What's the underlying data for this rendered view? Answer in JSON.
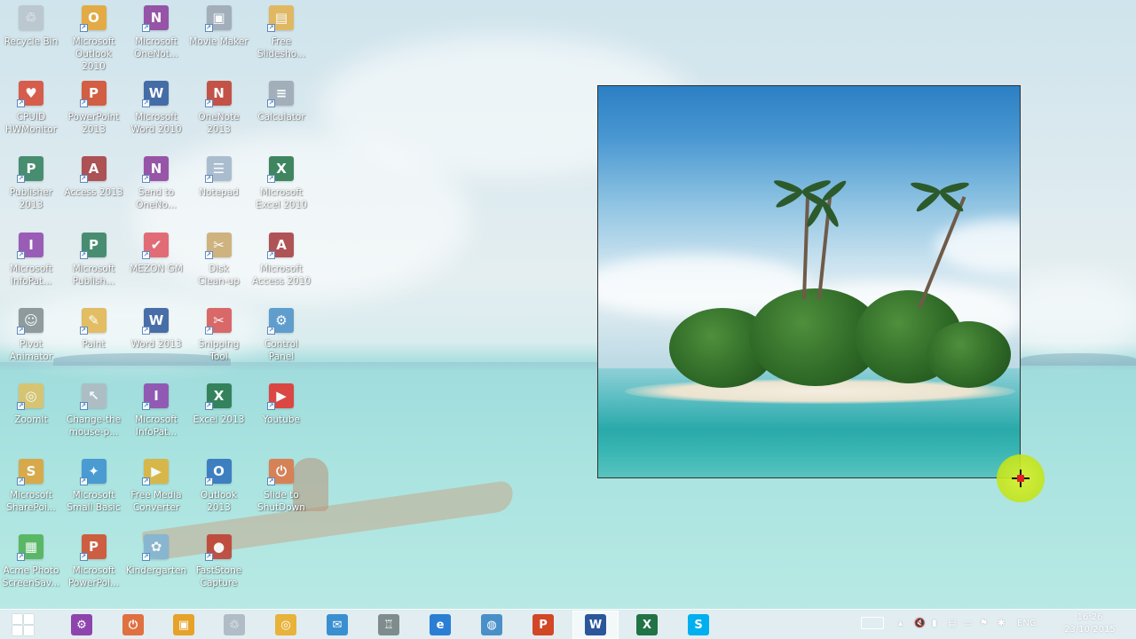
{
  "desktop_icons": [
    {
      "label": "Recycle Bin",
      "icon": "recycle-bin-icon",
      "color": "#b8c4cc"
    },
    {
      "label": "Microsoft\nOutlook 2010",
      "icon": "outlook-icon",
      "color": "#e6a229"
    },
    {
      "label": "Microsoft\nOneNot...",
      "icon": "onenote-icon",
      "color": "#8b3b9b"
    },
    {
      "label": "Movie Maker",
      "icon": "movie-maker-icon",
      "color": "#9aa6b2"
    },
    {
      "label": "Free\nSlidesho...",
      "icon": "slideshow-icon",
      "color": "#e3b14a"
    },
    {
      "label": "CPUID\nHWMonitor",
      "icon": "hwmonitor-icon",
      "color": "#d7452f"
    },
    {
      "label": "PowerPoint\n2013",
      "icon": "powerpoint-icon",
      "color": "#d24726"
    },
    {
      "label": "Microsoft\nWord 2010",
      "icon": "word-icon",
      "color": "#2b579a"
    },
    {
      "label": "OneNote\n2013",
      "icon": "onenote-icon",
      "color": "#c0392b"
    },
    {
      "label": "Calculator",
      "icon": "calculator-icon",
      "color": "#9aa6b2"
    },
    {
      "label": "Publisher\n2013",
      "icon": "publisher-icon",
      "color": "#2e7d5b"
    },
    {
      "label": "Access 2013",
      "icon": "access-icon",
      "color": "#a4373a"
    },
    {
      "label": "Send to\nOneNo...",
      "icon": "send-onenote-icon",
      "color": "#8b3b9b"
    },
    {
      "label": "Notepad",
      "icon": "notepad-icon",
      "color": "#9fb4c8"
    },
    {
      "label": "Microsoft\nExcel 2010",
      "icon": "excel-icon",
      "color": "#217346"
    },
    {
      "label": "Microsoft\nInfoPat...",
      "icon": "infopath-icon",
      "color": "#8e44ad"
    },
    {
      "label": "Microsoft\nPublish...",
      "icon": "publisher-icon",
      "color": "#2e7d5b"
    },
    {
      "label": "MEZON GM",
      "icon": "mezon-icon",
      "color": "#e05560"
    },
    {
      "label": "Disk\nClean-up",
      "icon": "disk-cleanup-icon",
      "color": "#c8a86a"
    },
    {
      "label": "Microsoft\nAccess 2010",
      "icon": "access-icon",
      "color": "#a4373a"
    },
    {
      "label": "Pivot\nAnimator",
      "icon": "pivot-animator-icon",
      "color": "#7f8c8d"
    },
    {
      "label": "Paint",
      "icon": "paint-icon",
      "color": "#e0b44a"
    },
    {
      "label": "Word 2013",
      "icon": "word-icon",
      "color": "#2b579a"
    },
    {
      "label": "Snipping\nTool",
      "icon": "snipping-tool-icon",
      "color": "#d65050"
    },
    {
      "label": "Control\nPanel",
      "icon": "control-panel-icon",
      "color": "#4a90c8"
    },
    {
      "label": "ZoomIt",
      "icon": "zoomit-icon",
      "color": "#e0c060"
    },
    {
      "label": "Change-the\nmouse-p...",
      "icon": "mouse-pointer-icon",
      "color": "#b0b8c0"
    },
    {
      "label": "Microsoft\nInfoPat...",
      "icon": "infopath-icon",
      "color": "#8e44ad"
    },
    {
      "label": "Excel 2013",
      "icon": "excel-icon",
      "color": "#217346"
    },
    {
      "label": "Youtube",
      "icon": "youtube-icon",
      "color": "#e52d27"
    },
    {
      "label": "Microsoft\nSharePoi...",
      "icon": "sharepoint-icon",
      "color": "#e0a030"
    },
    {
      "label": "Microsoft\nSmall Basic",
      "icon": "small-basic-icon",
      "color": "#3a8fd0"
    },
    {
      "label": "Free Media\nConverter",
      "icon": "media-converter-icon",
      "color": "#e0b030"
    },
    {
      "label": "Outlook 2013",
      "icon": "outlook-icon",
      "color": "#2a6ebb"
    },
    {
      "label": "Slide to\nShutDown",
      "icon": "shutdown-icon",
      "color": "#e07040"
    },
    {
      "label": "Acme Photo\nScreenSav...",
      "icon": "photo-screensaver-icon",
      "color": "#4caf50"
    },
    {
      "label": "Microsoft\nPowerPoi...",
      "icon": "powerpoint-icon",
      "color": "#d24726"
    },
    {
      "label": "Kindergarten",
      "icon": "kindergarten-icon",
      "color": "#7fb3d5"
    },
    {
      "label": "FastStone\nCapture",
      "icon": "faststone-capture-icon",
      "color": "#c0392b"
    }
  ],
  "icon_letters": {
    "word-icon": "W",
    "excel-icon": "X",
    "powerpoint-icon": "P",
    "access-icon": "A",
    "onenote-icon": "N",
    "publisher-icon": "P",
    "outlook-icon": "O",
    "infopath-icon": "I",
    "sharepoint-icon": "S",
    "send-onenote-icon": "N",
    "youtube-icon": "▶",
    "shutdown-icon": "⏻",
    "recycle-bin-icon": "♲",
    "calculator-icon": "≡",
    "control-panel-icon": "⚙",
    "paint-icon": "✎",
    "notepad-icon": "☰",
    "movie-maker-icon": "▣",
    "slideshow-icon": "▤",
    "hwmonitor-icon": "♥",
    "mezon-icon": "✔",
    "disk-cleanup-icon": "✂",
    "pivot-animator-icon": "☺",
    "snipping-tool-icon": "✂",
    "zoomit-icon": "◎",
    "mouse-pointer-icon": "↖",
    "small-basic-icon": "✦",
    "media-converter-icon": "▶",
    "photo-screensaver-icon": "▦",
    "kindergarten-icon": "✿",
    "faststone-capture-icon": "●"
  },
  "taskbar": {
    "apps": [
      {
        "name": "start-button",
        "icon": "windows-logo-icon"
      },
      {
        "name": "taskbar-settings",
        "icon": "gear-icon",
        "color": "#8e44ad",
        "glyph": "⚙"
      },
      {
        "name": "taskbar-shutdown",
        "icon": "power-icon",
        "color": "#e07040",
        "glyph": "⏻"
      },
      {
        "name": "taskbar-picture-tool",
        "icon": "picture-icon",
        "color": "#e6a229",
        "glyph": "▣"
      },
      {
        "name": "taskbar-recycle-bin",
        "icon": "recycle-bin-icon",
        "color": "#b0bcc6",
        "glyph": "♲"
      },
      {
        "name": "taskbar-chrome",
        "icon": "chrome-icon",
        "color": "#e8b33a",
        "glyph": "◎"
      },
      {
        "name": "taskbar-mail",
        "icon": "mail-icon",
        "color": "#3a8fd0",
        "glyph": "✉"
      },
      {
        "name": "taskbar-student",
        "icon": "graduation-cap-icon",
        "color": "#7f8c8d",
        "glyph": "♖"
      },
      {
        "name": "taskbar-internet-explorer",
        "icon": "internet-explorer-icon",
        "color": "#2a7fd4",
        "glyph": "e"
      },
      {
        "name": "taskbar-globe",
        "icon": "globe-icon",
        "color": "#4a90c8",
        "glyph": "◍"
      },
      {
        "name": "taskbar-powerpoint",
        "icon": "powerpoint-icon",
        "color": "#d24726",
        "glyph": "P"
      },
      {
        "name": "taskbar-word",
        "icon": "word-icon",
        "color": "#2b579a",
        "glyph": "W",
        "active": true
      },
      {
        "name": "taskbar-excel",
        "icon": "excel-icon",
        "color": "#217346",
        "glyph": "X"
      },
      {
        "name": "taskbar-skype",
        "icon": "skype-icon",
        "color": "#00aff0",
        "glyph": "S"
      }
    ],
    "tray": {
      "language": "ENG",
      "time": "16:26",
      "date": "23/10/2015"
    }
  }
}
